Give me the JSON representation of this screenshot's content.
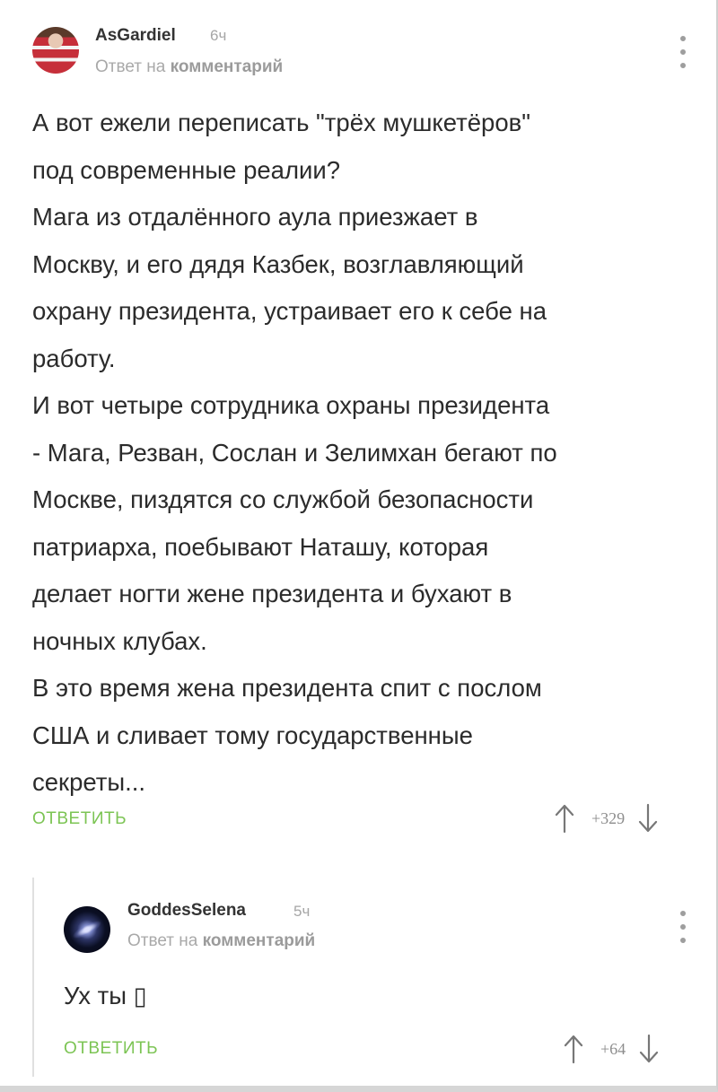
{
  "comments": [
    {
      "author": "AsGardiel",
      "time": "6ч",
      "reply_to_prefix": "Ответ на ",
      "reply_to_link": "комментарий",
      "text": "А вот ежели переписать \"трёх мушкетёров\"\nпод современные реалии?\nМага из отдалённого аула приезжает в\nМоскву, и его дядя Казбек, возглавляющий\nохрану президента, устраивает его к себе на\nработу.\nИ вот четыре сотрудника охраны президента\n- Мага, Резван, Сослан и Зелимхан бегают по\nМоскве, пиздятся со службой безопасности\nпатриарха, поебывают Наташу, которая\nделает ногти жене президента и бухают в\nночных клубах.\nВ это время жена президента спит с послом\nСША и сливает тому государственные\nсекреты...",
      "reply_label": "ОТВЕТИТЬ",
      "score": "+329",
      "avatar_icon": "user-avatar-icon"
    },
    {
      "author": "GoddesSelena",
      "time": "5ч",
      "reply_to_prefix": "Ответ на ",
      "reply_to_link": "комментарий",
      "text": "Ух ты ▯",
      "reply_label": "ОТВЕТИТЬ",
      "score": "+64",
      "avatar_icon": "galaxy-avatar-icon"
    }
  ],
  "colors": {
    "accent_green": "#7cc454",
    "muted_text": "#a9a9a9",
    "body_text": "#2b2b2b"
  },
  "icons": {
    "upvote": "arrow-up-icon",
    "downvote": "arrow-down-icon",
    "menu": "more-vertical-icon"
  }
}
